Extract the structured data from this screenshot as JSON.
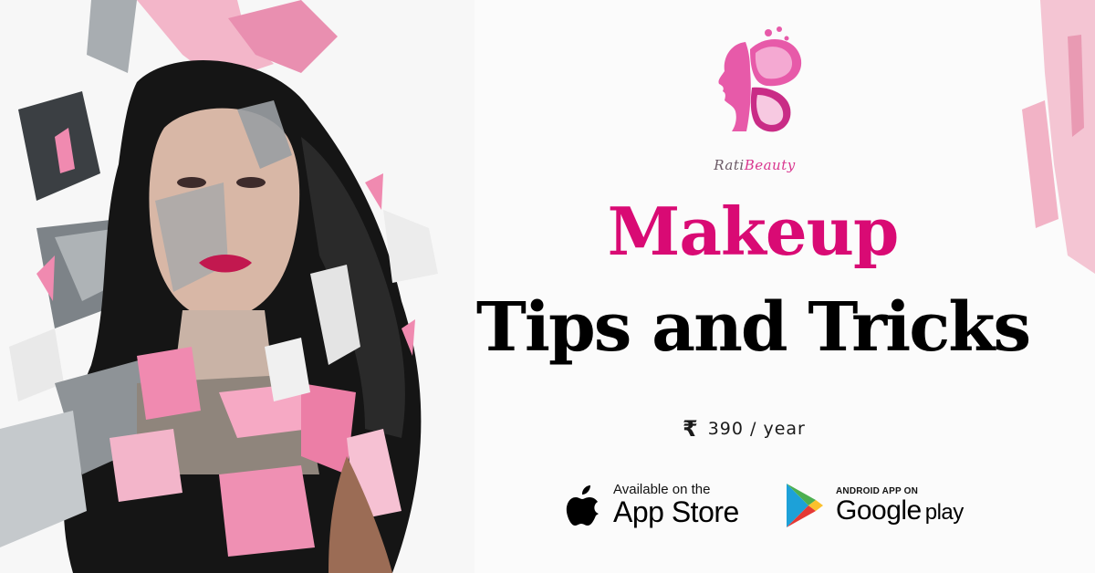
{
  "brand": {
    "name_part1": "Rati",
    "name_part2": "Beauty",
    "logo_colors": [
      "#e75aa9",
      "#f4a9d2",
      "#c92c86"
    ]
  },
  "headline": {
    "line1": "Makeup",
    "line2": "Tips and Tricks",
    "accent_color": "#d90a74"
  },
  "price": {
    "currency_symbol": "₹",
    "amount_text": "390 / year"
  },
  "app_store": {
    "small_text": "Available on the",
    "big_text": "App Store",
    "icon": "apple-icon"
  },
  "google_play": {
    "small_text": "ANDROID APP ON",
    "big_text": "Google",
    "big_suffix": "play",
    "icon": "google-play-icon"
  },
  "artwork": {
    "description_icon": "woman-portrait-collage",
    "palette": [
      "#f08ab0",
      "#8c9196",
      "#1c1c1c",
      "#ffffff"
    ]
  }
}
